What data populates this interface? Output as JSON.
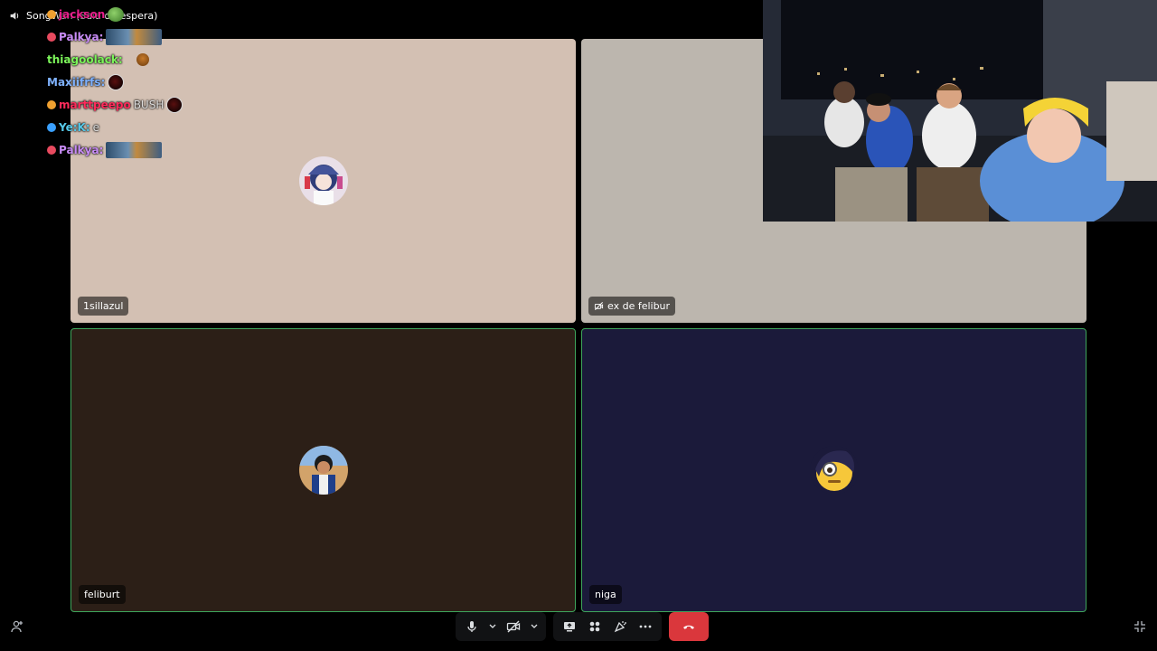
{
  "window": {
    "title": "SongWan (Sala de espera)"
  },
  "chat": {
    "messages": [
      {
        "user": "jackson",
        "user_color": "#e91e8c",
        "badge_color": "#f0a030",
        "text": "",
        "emote": "emote-frog"
      },
      {
        "user": "Palkya:",
        "user_color": "#c78bf5",
        "badge_color": "#e84a5f",
        "text": "",
        "emote": "emote-img"
      },
      {
        "user": "thiagoolack:",
        "user_color": "#7cf55a",
        "badge_color": "",
        "text": "",
        "emote": "emote-small"
      },
      {
        "user": "Maxiifrfs:",
        "user_color": "#7fb2ff",
        "badge_color": "",
        "text": "",
        "emote": "emote-ball"
      },
      {
        "user": "marttpeepo",
        "user_color": "#ff2b5b",
        "badge_color": "#f0a030",
        "text": "BUSH",
        "emote": "emote-ball"
      },
      {
        "user": "Ye:K:",
        "user_color": "#55c8e8",
        "badge_color": "#3aa0ff",
        "text": "e",
        "emote": ""
      },
      {
        "user": "Palkya:",
        "user_color": "#c78bf5",
        "badge_color": "#e84a5f",
        "text": "",
        "emote": "emote-img"
      }
    ]
  },
  "participants": [
    {
      "name": "1sillazul",
      "muted": false,
      "speaking": false
    },
    {
      "name": "ex de felibur",
      "muted": true,
      "speaking": false
    },
    {
      "name": "feliburt",
      "muted": false,
      "speaking": true
    },
    {
      "name": "niga",
      "muted": false,
      "speaking": true
    }
  ],
  "controls": {
    "mic_icon": "microphone-icon",
    "camera_icon": "camera-off-icon",
    "screen_share_icon": "screen-share-icon",
    "activities_icon": "activities-icon",
    "soundboard_icon": "soundboard-icon",
    "more_icon": "more-icon",
    "end_call_icon": "phone-hangup-icon"
  },
  "colors": {
    "speaking_border": "#3ea55b",
    "end_call": "#da373c"
  }
}
